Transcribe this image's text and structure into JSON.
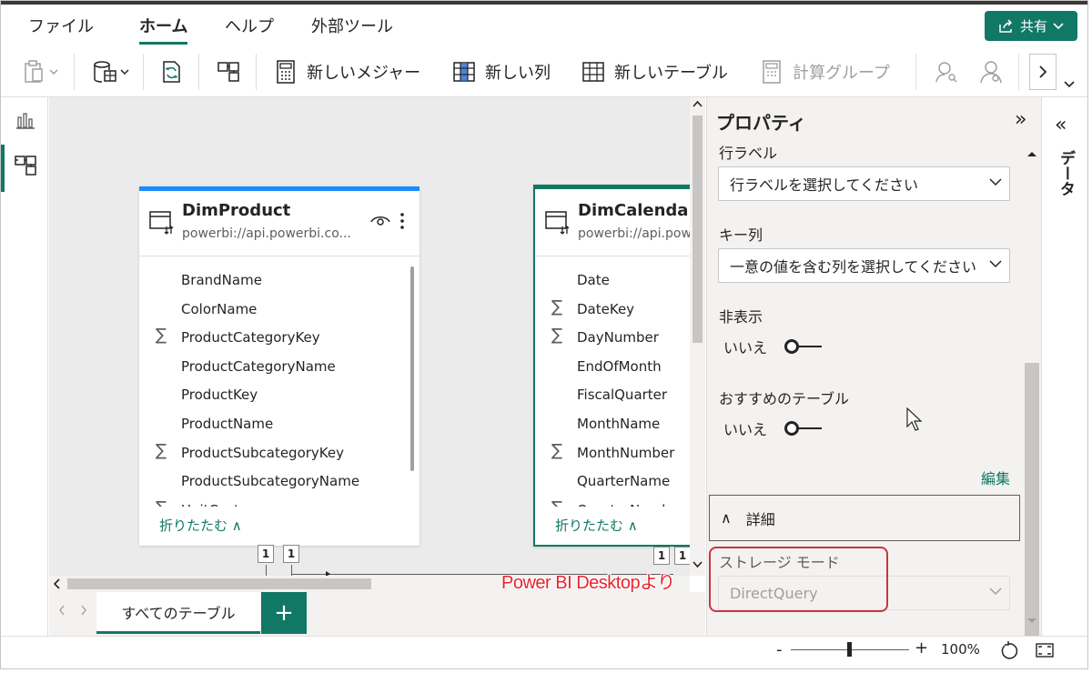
{
  "menu": {
    "items": [
      "ファイル",
      "ホーム",
      "ヘルプ",
      "外部ツール"
    ],
    "active": "ホーム",
    "share_label": "共有"
  },
  "ribbon": {
    "new_measure": "新しいメジャー",
    "new_column": "新しい列",
    "new_table": "新しいテーブル",
    "calc_group": "計算グループ"
  },
  "cards": [
    {
      "title": "DimProduct",
      "source": "powerbi://api.powerbi.co...",
      "fields": [
        {
          "name": "BrandName",
          "sum": false
        },
        {
          "name": "ColorName",
          "sum": false
        },
        {
          "name": "ProductCategoryKey",
          "sum": true
        },
        {
          "name": "ProductCategoryName",
          "sum": false
        },
        {
          "name": "ProductKey",
          "sum": false
        },
        {
          "name": "ProductName",
          "sum": false
        },
        {
          "name": "ProductSubcategoryKey",
          "sum": true
        },
        {
          "name": "ProductSubcategoryName",
          "sum": false
        },
        {
          "name": "UnitCost",
          "sum": true
        }
      ],
      "collapse": "折りたたむ ∧"
    },
    {
      "title": "DimCalendar",
      "source": "powerbi://api.pow",
      "fields": [
        {
          "name": "Date",
          "sum": false
        },
        {
          "name": "DateKey",
          "sum": true
        },
        {
          "name": "DayNumber",
          "sum": true
        },
        {
          "name": "EndOfMonth",
          "sum": false
        },
        {
          "name": "FiscalQuarter",
          "sum": false
        },
        {
          "name": "MonthName",
          "sum": false
        },
        {
          "name": "MonthNumber",
          "sum": true
        },
        {
          "name": "QuarterName",
          "sum": false
        },
        {
          "name": "QuarterNumber",
          "sum": true
        }
      ],
      "collapse": "折りたたむ ∧"
    }
  ],
  "relationships": {
    "badge": "1"
  },
  "tabs": {
    "label": "すべてのテーブル",
    "add": "+"
  },
  "properties": {
    "title": "プロパティ",
    "collapse_glyph": "»",
    "row_label_title": "行ラベル",
    "row_label_placeholder": "行ラベルを選択してください",
    "key_column_title": "キー列",
    "key_column_placeholder": "一意の値を含む列を選択してください",
    "hidden_title": "非表示",
    "hidden_value": "いいえ",
    "featured_title": "おすすめのテーブル",
    "featured_value": "いいえ",
    "edit_link": "編集",
    "details_label": "詳細",
    "details_glyph": "∧",
    "storage_mode_title": "ストレージ モード",
    "storage_mode_value": "DirectQuery"
  },
  "annotation": "Power BI Desktopより",
  "data_pane": {
    "label": "データ",
    "collapse_glyph": "«"
  },
  "status": {
    "zoom": "100%",
    "minus": "-",
    "plus": "+"
  },
  "colors": {
    "accent": "#117865",
    "card_top": "#1a8cff",
    "annotation": "#e8242d"
  }
}
